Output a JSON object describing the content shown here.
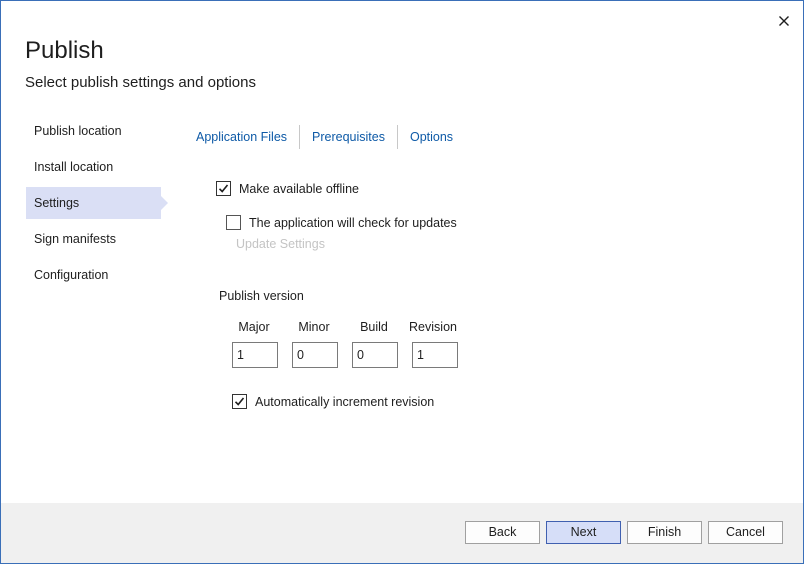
{
  "dialog": {
    "title": "Publish",
    "subtitle": "Select publish settings and options"
  },
  "sidebar": {
    "items": [
      {
        "label": "Publish location",
        "selected": false
      },
      {
        "label": "Install location",
        "selected": false
      },
      {
        "label": "Settings",
        "selected": true
      },
      {
        "label": "Sign manifests",
        "selected": false
      },
      {
        "label": "Configuration",
        "selected": false
      }
    ]
  },
  "tabs": [
    {
      "label": "Application Files"
    },
    {
      "label": "Prerequisites"
    },
    {
      "label": "Options"
    }
  ],
  "settings": {
    "offline_label": "Make available offline",
    "offline_checked": true,
    "updates_label": "The application will check for updates",
    "updates_checked": false,
    "update_settings_label": "Update Settings"
  },
  "version": {
    "section_label": "Publish version",
    "fields": [
      {
        "label": "Major",
        "value": "1"
      },
      {
        "label": "Minor",
        "value": "0"
      },
      {
        "label": "Build",
        "value": "0"
      },
      {
        "label": "Revision",
        "value": "1"
      }
    ],
    "auto_increment_label": "Automatically increment revision",
    "auto_increment_checked": true
  },
  "buttons": {
    "back": "Back",
    "next": "Next",
    "finish": "Finish",
    "cancel": "Cancel"
  },
  "colors": {
    "accent_link": "#0e5aa7",
    "selected_nav": "#dadff5",
    "primary_button": "#d6def8",
    "window_border": "#3a6fb8"
  }
}
